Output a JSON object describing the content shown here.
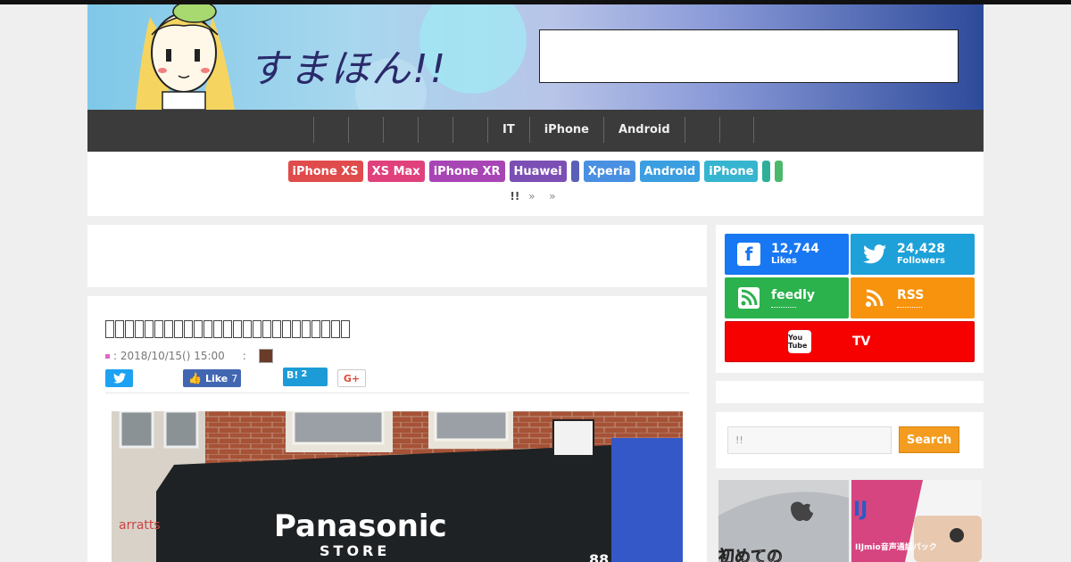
{
  "header": {
    "logo_text": "すまほん!!"
  },
  "nav": {
    "items": [
      "",
      "",
      "",
      "",
      "",
      "IT",
      "iPhone",
      "Android",
      "",
      ""
    ]
  },
  "tags": [
    {
      "label": "iPhone XS",
      "color": "#e04b4b"
    },
    {
      "label": "XS Max",
      "color": "#e0417c"
    },
    {
      "label": "iPhone XR",
      "color": "#a845b5"
    },
    {
      "label": "Huawei",
      "color": "#7b4fb3"
    },
    {
      "label": "",
      "color": "#5a5fb8"
    },
    {
      "label": "Xperia",
      "color": "#4a90e2"
    },
    {
      "label": "Android",
      "color": "#3a9ee0"
    },
    {
      "label": "iPhone",
      "color": "#36b5d0"
    },
    {
      "label": "",
      "color": "#2eaf9a"
    },
    {
      "label": "",
      "color": "#4cb86a"
    }
  ],
  "breadcrumbs": {
    "home": "!!",
    "sep1": "»",
    "sep2": "»"
  },
  "article": {
    "title": "",
    "date": ": 2018/10/15() 15:00",
    "author_sep": ":",
    "share": {
      "like_label": "Like",
      "like_count": "7",
      "hatena_label": "B!",
      "hatena_count": "2",
      "gplus_label": "G+"
    },
    "photo_sign": "Panasonic",
    "photo_sign_sub": "STORE",
    "photo_left_sign": "arratts",
    "photo_number": "88"
  },
  "sidebar": {
    "social": [
      {
        "name": "facebook",
        "count": "12,744",
        "label": "Likes",
        "color": "#1877f2"
      },
      {
        "name": "twitter",
        "count": "24,428",
        "label": "Followers",
        "color": "#1da1d8"
      },
      {
        "name": "feedly",
        "count": "feedly",
        "label": "",
        "color": "#2bb24c"
      },
      {
        "name": "rss",
        "count": "RSS",
        "label": "",
        "color": "#f7930c"
      }
    ],
    "youtube_label": "TV",
    "youtube_icon_text": "You Tube",
    "search_placeholder": "!!",
    "search_button": "Search",
    "thumb1_text": "初めての",
    "thumb2_text": "IIJmio音声通話パック"
  },
  "colors": {
    "nav_bg": "#3b3b3b",
    "youtube": "#f70000",
    "search_button": "#f39c1f"
  }
}
